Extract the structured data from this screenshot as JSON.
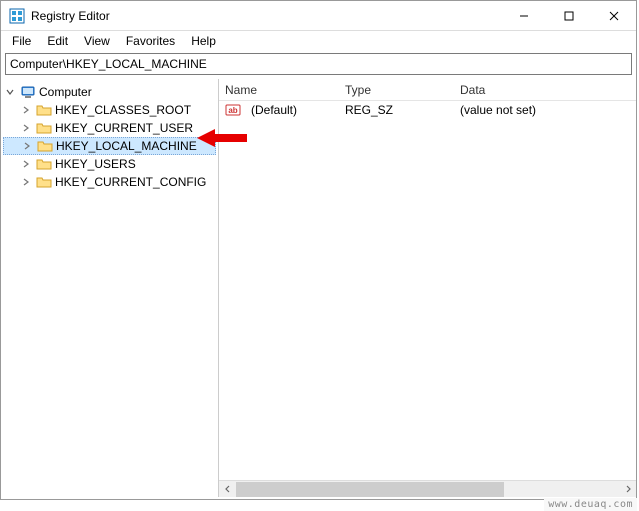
{
  "window": {
    "title": "Registry Editor"
  },
  "window_controls": {
    "minimize": "minimize",
    "maximize": "maximize",
    "close": "close"
  },
  "menubar": {
    "file": "File",
    "edit": "Edit",
    "view": "View",
    "favorites": "Favorites",
    "help": "Help"
  },
  "addressbar": {
    "value": "Computer\\HKEY_LOCAL_MACHINE"
  },
  "tree": {
    "root": {
      "label": "Computer",
      "icon": "computer-icon",
      "expanded": true
    },
    "items": [
      {
        "label": "HKEY_CLASSES_ROOT",
        "selected": false
      },
      {
        "label": "HKEY_CURRENT_USER",
        "selected": false
      },
      {
        "label": "HKEY_LOCAL_MACHINE",
        "selected": true
      },
      {
        "label": "HKEY_USERS",
        "selected": false
      },
      {
        "label": "HKEY_CURRENT_CONFIG",
        "selected": false
      }
    ]
  },
  "list": {
    "headers": {
      "name": "Name",
      "type": "Type",
      "data": "Data"
    },
    "rows": [
      {
        "name": "(Default)",
        "type": "REG_SZ",
        "data": "(value not set)",
        "icon": "string-value-icon"
      }
    ]
  },
  "watermark": "www.deuaq.com"
}
